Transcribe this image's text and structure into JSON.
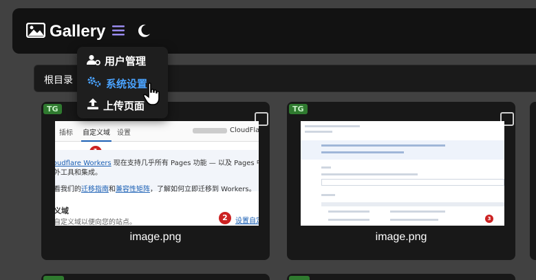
{
  "header": {
    "title": "Gallery",
    "menu_icon": "hamburger-menu-icon",
    "theme_icon": "moon-icon"
  },
  "dropdown": {
    "items": [
      {
        "label": "用户管理",
        "icon": "user-gear-icon"
      },
      {
        "label": "系统设置",
        "icon": "gears-icon",
        "active": true
      },
      {
        "label": "上传页面",
        "icon": "upload-icon"
      }
    ]
  },
  "breadcrumb": {
    "root": "根目录"
  },
  "cards": [
    {
      "badge": "TG",
      "caption": "image.png",
      "thumb": {
        "tabs": [
          "插标",
          "自定义域",
          "设置"
        ],
        "right_text": "CloudFlare",
        "line1_link": "loudflare Workers",
        "line1_rest": " 现在支持几乎所有 Pages 功能 — 以及 Pages 中没有的",
        "line2": "外工具和集成。",
        "line3_pre": "看我们的",
        "line3_link1": "迁移指南",
        "line3_mid": "和",
        "line3_link2": "兼容性矩阵",
        "line3_post": "，了解如何立即迁移到 Workers。",
        "section_title": "义域",
        "section_desc": "自定义域以便向您的站点。",
        "action_link": "设置自定",
        "marker1": "1",
        "marker2": "2"
      }
    },
    {
      "badge": "TG",
      "caption": "image.png",
      "thumb": {
        "marker": "3"
      }
    }
  ],
  "colors": {
    "accent": "#4aa3ff",
    "badge_bg": "#2f7a2f",
    "marker": "#cc2222",
    "page_bg": "#414141",
    "card_bg": "#181818"
  }
}
